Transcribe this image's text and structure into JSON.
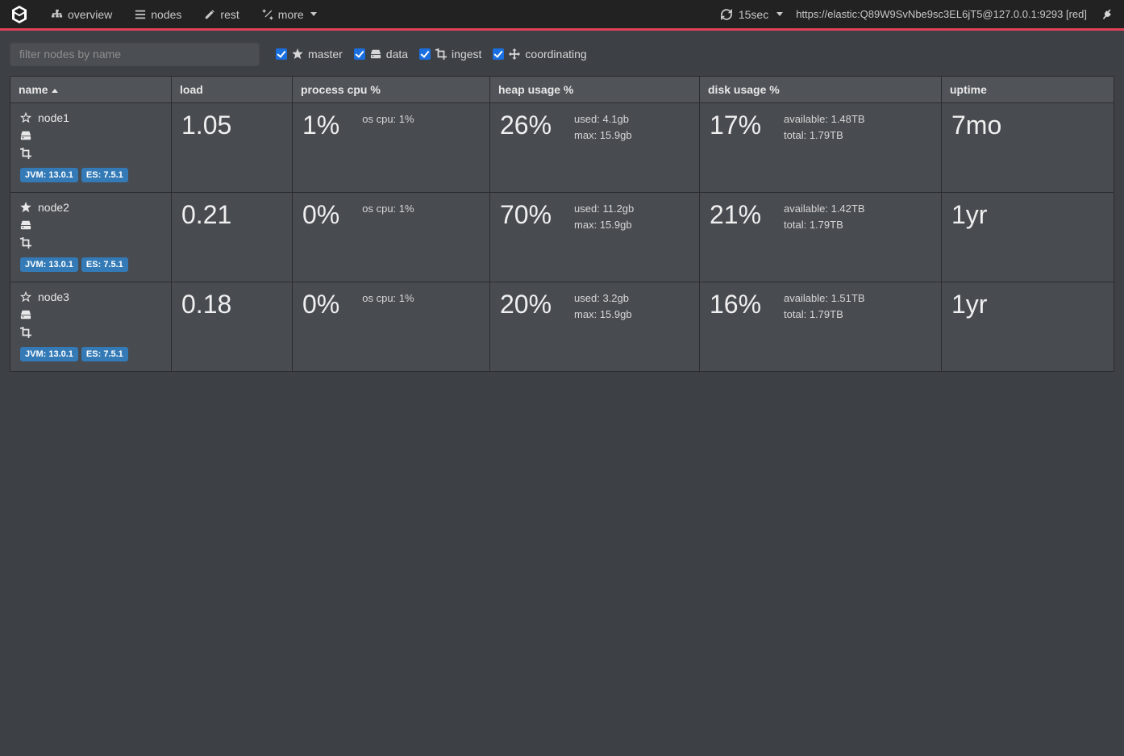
{
  "nav": {
    "overview": "overview",
    "nodes": "nodes",
    "rest": "rest",
    "more": "more",
    "refresh_interval": "15sec",
    "cluster_url": "https://elastic:Q89W9SvNbe9sc3EL6jT5@127.0.0.1:9293 [red]"
  },
  "toolbar": {
    "filter_placeholder": "filter nodes by name",
    "checks": {
      "master": "master",
      "data": "data",
      "ingest": "ingest",
      "coordinating": "coordinating"
    }
  },
  "columns": {
    "name": "name",
    "load": "load",
    "cpu": "process cpu %",
    "heap": "heap usage %",
    "disk": "disk usage %",
    "uptime": "uptime"
  },
  "badges": {
    "jvm": "JVM: 13.0.1",
    "es": "ES: 7.5.1"
  },
  "nodes": [
    {
      "name": "node1",
      "load": "1.05",
      "cpu": "1%",
      "os_cpu": "os cpu: 1%",
      "heap": "26%",
      "heap_used": "used: 4.1gb",
      "heap_max": "max: 15.9gb",
      "disk": "17%",
      "disk_avail": "available: 1.48TB",
      "disk_total": "total: 1.79TB",
      "uptime": "7mo"
    },
    {
      "name": "node2",
      "load": "0.21",
      "cpu": "0%",
      "os_cpu": "os cpu: 1%",
      "heap": "70%",
      "heap_used": "used: 11.2gb",
      "heap_max": "max: 15.9gb",
      "disk": "21%",
      "disk_avail": "available: 1.42TB",
      "disk_total": "total: 1.79TB",
      "uptime": "1yr"
    },
    {
      "name": "node3",
      "load": "0.18",
      "cpu": "0%",
      "os_cpu": "os cpu: 1%",
      "heap": "20%",
      "heap_used": "used: 3.2gb",
      "heap_max": "max: 15.9gb",
      "disk": "16%",
      "disk_avail": "available: 1.51TB",
      "disk_total": "total: 1.79TB",
      "uptime": "1yr"
    }
  ]
}
